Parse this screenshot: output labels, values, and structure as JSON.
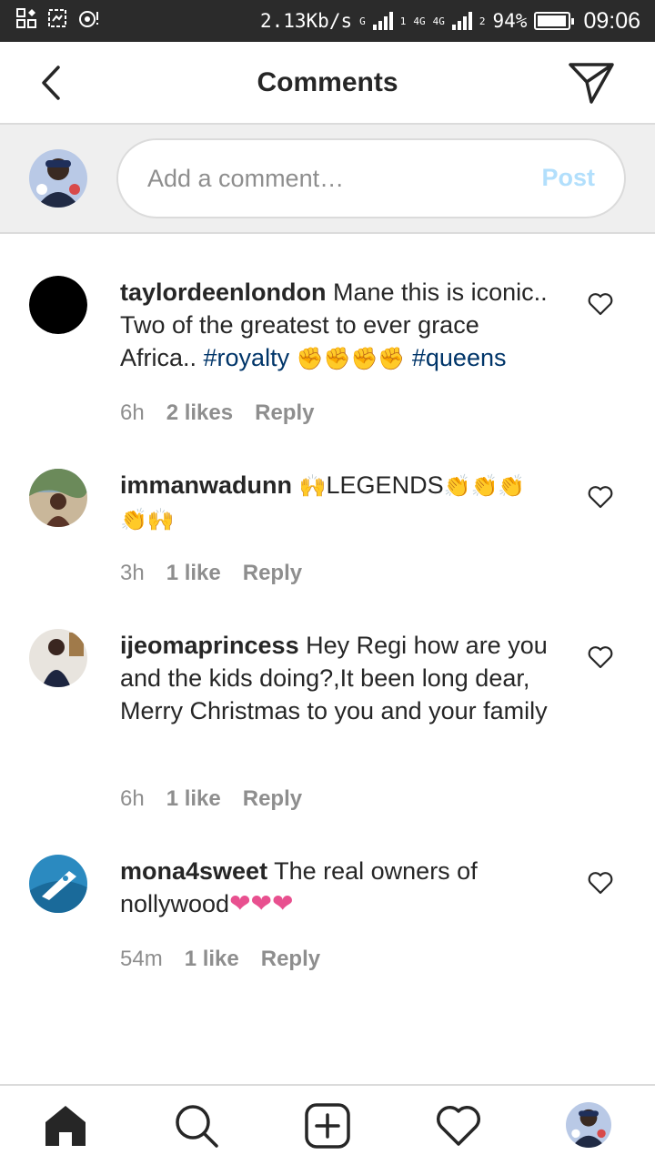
{
  "status_bar": {
    "speed": "2.13Kb/s",
    "network_1": "G",
    "network_2": "4G",
    "network_3": "4G",
    "sim_1": "1",
    "sim_2": "2",
    "battery": "94%",
    "battery_level": 0.94,
    "time": "09:06"
  },
  "header": {
    "title": "Comments",
    "back_icon": "chevron-left-icon",
    "send_icon": "paper-plane-icon"
  },
  "composer": {
    "placeholder": "Add a comment…",
    "value": "",
    "post_label": "Post",
    "post_color": "#b2dffc"
  },
  "comments": [
    {
      "username": "taylordeenlondon",
      "text_before": " Mane this is iconic.. Two of the greatest to ever grace Africa.. ",
      "tag_1": "#royalty",
      "emoji": " ✊✊✊✊ ",
      "tag_2": "#queens",
      "time": "6h",
      "likes": "2 likes",
      "reply": "Reply"
    },
    {
      "username": "immanwadunn",
      "emoji_1": " 🙌",
      "text": "LEGENDS",
      "emoji_2": "👏👏👏 👏🙌",
      "time": "3h",
      "likes": "1 like",
      "reply": "Reply"
    },
    {
      "username": "ijeomaprincess",
      "text": " Hey Regi how are you and the kids doing?,It been long dear, Merry Christmas to you and your family",
      "time": "6h",
      "likes": "1 like",
      "reply": "Reply"
    },
    {
      "username": "mona4sweet",
      "text": " The real owners of nollywood",
      "emoji": "❤❤❤",
      "time": "54m",
      "likes": "1 like",
      "reply": "Reply"
    }
  ],
  "bottom_nav": [
    "home-icon",
    "search-icon",
    "new-post-icon",
    "activity-heart-icon",
    "profile-avatar"
  ],
  "colors": {
    "hashtag": "#003569",
    "meta_text": "#8e8e8e",
    "divider": "#dbdbdb",
    "composer_bg": "#efefef"
  }
}
